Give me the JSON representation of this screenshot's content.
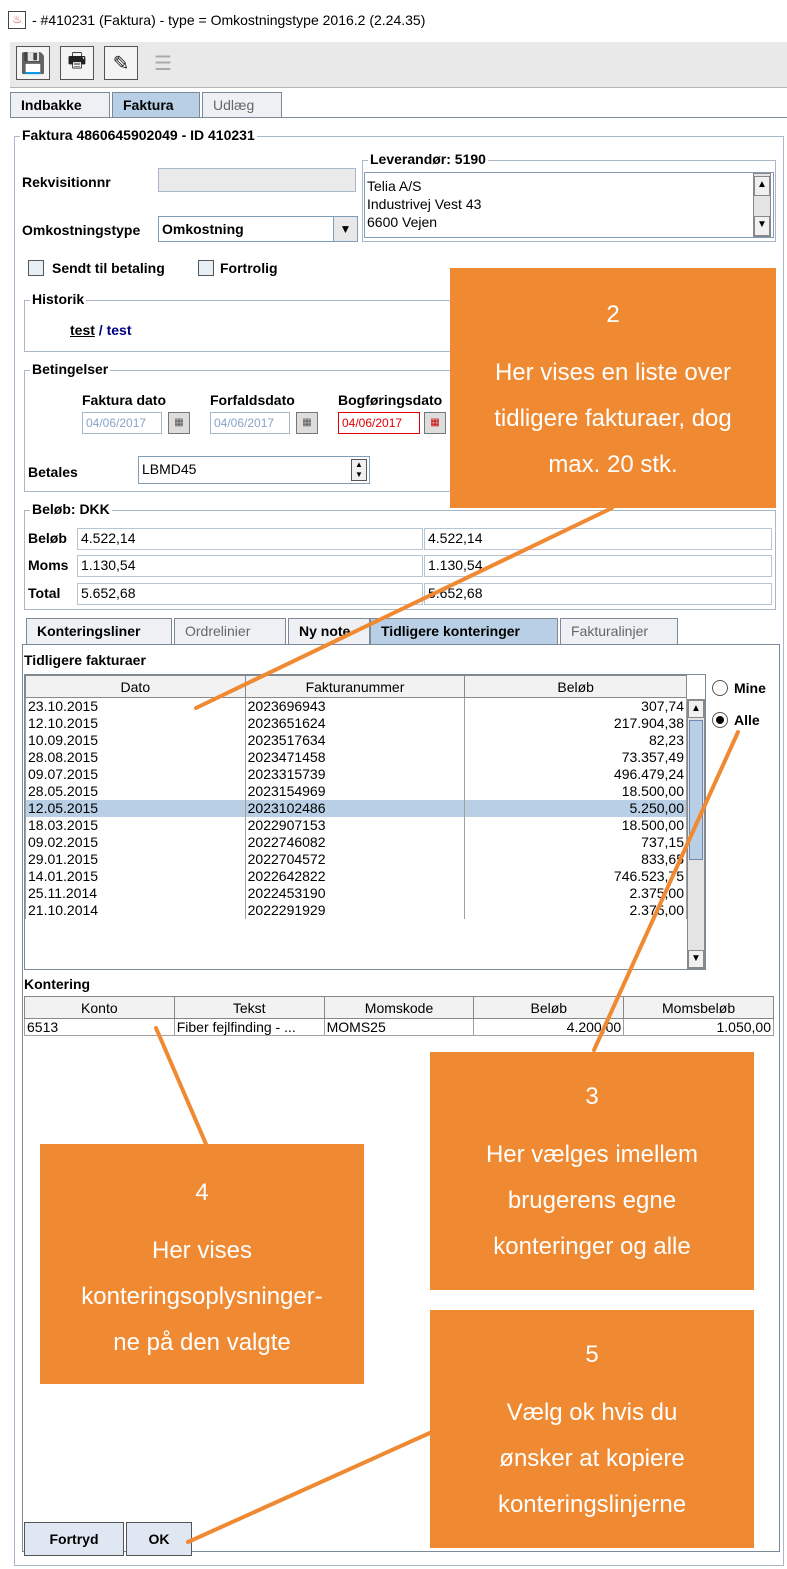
{
  "window": {
    "title": "- #410231 (Faktura) - type = Omkostningstype  2016.2 (2.24.35)"
  },
  "toolbar": {
    "icons": [
      "save-icon",
      "print-icon",
      "edit-icon",
      "list-icon"
    ]
  },
  "main_tabs": [
    {
      "label": "Indbakke"
    },
    {
      "label": "Faktura"
    },
    {
      "label": "Udlæg"
    }
  ],
  "invoice": {
    "header": "Faktura 4860645902049 - ID 410231",
    "rekvisition_label": "Rekvisitionnr",
    "rekvisition_value": "",
    "omkostning_label": "Omkostningstype",
    "omkostning_value": "Omkostning",
    "leverandor_legend": "Leverandør: 5190",
    "leverandor_lines": [
      "Telia A/S",
      "Industrivej  Vest 43",
      "6600 Vejen"
    ],
    "sendt_label": "Sendt til betaling",
    "fortrolig_label": "Fortrolig"
  },
  "historik": {
    "legend": "Historik",
    "user": "test",
    "sep": " / ",
    "name": "test"
  },
  "betingelser": {
    "legend": "Betingelser",
    "faktura_dato_label": "Faktura dato",
    "faktura_dato": "04/06/2017",
    "forfaldsdato_label": "Forfaldsdato",
    "forfaldsdato": "04/06/2017",
    "bogforing_label": "Bogføringsdato",
    "bogforing": "04/06/2017",
    "betales_label": "Betales",
    "betales_value": "LBMD45"
  },
  "belob": {
    "legend": "Beløb: DKK",
    "rows": [
      {
        "label": "Beløb",
        "v1": "4.522,14",
        "v2": "4.522,14"
      },
      {
        "label": "Moms",
        "v1": "1.130,54",
        "v2": "1.130,54"
      },
      {
        "label": "Total",
        "v1": "5.652,68",
        "v2": "5.652,68"
      }
    ]
  },
  "sub_tabs": [
    {
      "label": "Konteringsliner"
    },
    {
      "label": "Ordrelinier"
    },
    {
      "label": "Ny note"
    },
    {
      "label": "Tidligere konteringer"
    },
    {
      "label": "Fakturalinjer"
    }
  ],
  "tidligere": {
    "title": "Tidligere fakturaer",
    "columns": [
      "Dato",
      "Fakturanummer",
      "Beløb"
    ],
    "rows": [
      [
        "23.10.2015",
        "2023696943",
        "307,74"
      ],
      [
        "12.10.2015",
        "2023651624",
        "217.904,38"
      ],
      [
        "10.09.2015",
        "2023517634",
        "82,23"
      ],
      [
        "28.08.2015",
        "2023471458",
        "73.357,49"
      ],
      [
        "09.07.2015",
        "2023315739",
        "496.479,24"
      ],
      [
        "28.05.2015",
        "2023154969",
        "18.500,00"
      ],
      [
        "12.05.2015",
        "2023102486",
        "5.250,00"
      ],
      [
        "18.03.2015",
        "2022907153",
        "18.500,00"
      ],
      [
        "09.02.2015",
        "2022746082",
        "737,15"
      ],
      [
        "29.01.2015",
        "2022704572",
        "833,65"
      ],
      [
        "14.01.2015",
        "2022642822",
        "746.523,75"
      ],
      [
        "25.11.2014",
        "2022453190",
        "2.375,00"
      ],
      [
        "21.10.2014",
        "2022291929",
        "2.375,00"
      ]
    ],
    "selected_row": 6,
    "radio_mine": "Mine",
    "radio_alle": "Alle"
  },
  "kontering": {
    "title": "Kontering",
    "columns": [
      "Konto",
      "Tekst",
      "Momskode",
      "Beløb",
      "Momsbeløb"
    ],
    "rows": [
      [
        "6513",
        "Fiber fejlfinding - ...",
        "MOMS25",
        "4.200,00",
        "1.050,00"
      ]
    ]
  },
  "buttons": {
    "fortryd": "Fortryd",
    "ok": "OK"
  },
  "callouts": [
    {
      "num": "2",
      "lines": [
        "Her vises en liste over",
        "tidligere fakturaer, dog",
        "max. 20 stk."
      ]
    },
    {
      "num": "3",
      "lines": [
        "Her vælges imellem",
        "brugerens egne",
        "konteringer og alle"
      ]
    },
    {
      "num": "4",
      "lines": [
        "Her vises",
        "konteringsoplysninger-",
        "ne på den valgte"
      ]
    },
    {
      "num": "5",
      "lines": [
        "Vælg ok hvis du",
        "ønsker at kopiere",
        "konteringslinjerne"
      ]
    }
  ],
  "colors": {
    "callout": "#ef8a33",
    "selection": "#b8cfe5",
    "invalid_date": "#e00000"
  }
}
